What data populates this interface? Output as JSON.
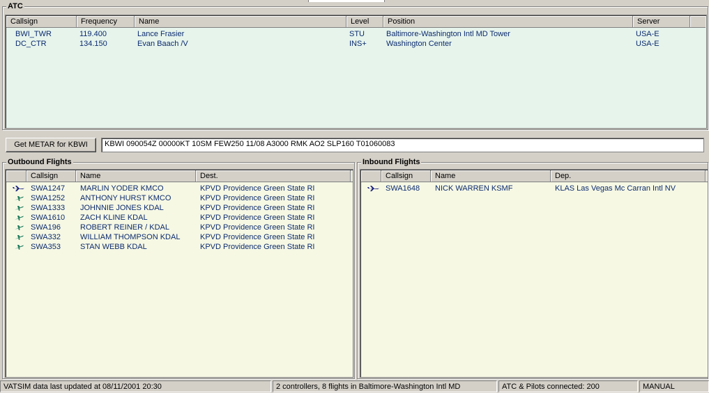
{
  "atc": {
    "title": "ATC",
    "columns": [
      "Callsign",
      "Frequency",
      "Name",
      "Level",
      "Position",
      "Server"
    ],
    "rows": [
      {
        "callsign": "BWI_TWR",
        "frequency": "119.400",
        "name": "Lance Frasier",
        "level": "STU",
        "position": "Baltimore-Washington Intl MD Tower",
        "server": "USA-E"
      },
      {
        "callsign": "DC_CTR",
        "frequency": "134.150",
        "name": "Evan Baach /V",
        "level": "INS+",
        "position": "Washington Center",
        "server": "USA-E"
      }
    ],
    "background": "#e6f4ec"
  },
  "metar": {
    "button_label": "Get METAR for KBWI",
    "value": "KBWI 090054Z 00000KT 10SM FEW250 11/08 A3000 RMK AO2 SLP160 T01060083"
  },
  "outbound": {
    "title": "Outbound Flights",
    "columns": [
      "",
      "Callsign",
      "Name",
      "Dest."
    ],
    "rows": [
      {
        "icon": "plane-icon",
        "callsign": "SWA1247",
        "name": "MARLIN YODER KMCO",
        "dest": "KPVD Providence Green State RI"
      },
      {
        "icon": "departing-plane-icon",
        "callsign": "SWA1252",
        "name": "ANTHONY HURST KMCO",
        "dest": "KPVD Providence Green State RI"
      },
      {
        "icon": "departing-plane-icon",
        "callsign": "SWA1333",
        "name": "JOHNNIE JONES KDAL",
        "dest": "KPVD Providence Green State RI"
      },
      {
        "icon": "departing-plane-icon",
        "callsign": "SWA1610",
        "name": "ZACH KLINE KDAL",
        "dest": "KPVD Providence Green State RI"
      },
      {
        "icon": "departing-plane-icon",
        "callsign": "SWA196",
        "name": "ROBERT REINER / KDAL",
        "dest": "KPVD Providence Green State RI"
      },
      {
        "icon": "departing-plane-icon",
        "callsign": "SWA332",
        "name": "WILLIAM THOMPSON KDAL",
        "dest": "KPVD Providence Green State RI"
      },
      {
        "icon": "departing-plane-icon",
        "callsign": "SWA353",
        "name": "STAN WEBB KDAL",
        "dest": "KPVD Providence Green State RI"
      }
    ],
    "background": "#f6f8e4"
  },
  "inbound": {
    "title": "Inbound Flights",
    "columns": [
      "",
      "Callsign",
      "Name",
      "Dep."
    ],
    "rows": [
      {
        "icon": "plane-icon",
        "callsign": "SWA1648",
        "name": "NICK WARREN KSMF",
        "dep": "KLAS Las Vegas Mc Carran Intl NV"
      }
    ],
    "background": "#f6f8e4"
  },
  "status": {
    "updated": "VATSIM data last updated at 08/11/2001 20:30",
    "summary": "2 controllers, 8 flights in Baltimore-Washington Intl MD",
    "connected": "ATC & Pilots connected: 200",
    "mode": "MANUAL"
  },
  "colors": {
    "row_text": "#0b2a6e",
    "plane_airborne": "#1a237e",
    "plane_departing": "#1b7a5a"
  }
}
